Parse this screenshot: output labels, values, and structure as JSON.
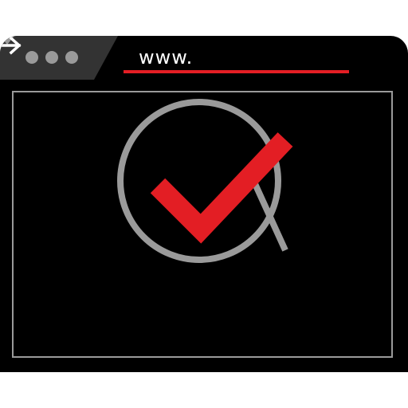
{
  "address_bar": {
    "url_text": "www."
  },
  "icons": {
    "window_controls": [
      "dot-icon",
      "dot-icon",
      "dot-icon"
    ],
    "dropdown": "triangle-down-icon",
    "go": "arrow-right-icon",
    "content": "magnifier-check-icon"
  },
  "colors": {
    "window": "#000000",
    "tab": "#333333",
    "controls": "#9a9a9a",
    "accent": "#e31e24",
    "text": "#ffffff"
  }
}
